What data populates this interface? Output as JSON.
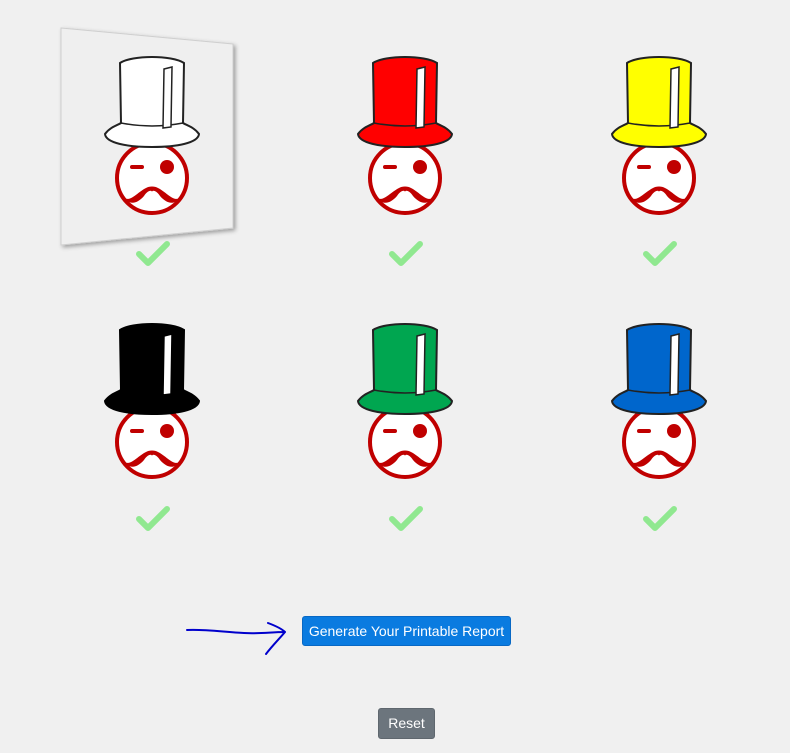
{
  "characters": [
    {
      "hat_color": "#ffffff",
      "selected": true,
      "checked": true
    },
    {
      "hat_color": "#ff0000",
      "selected": false,
      "checked": true
    },
    {
      "hat_color": "#ffff00",
      "selected": false,
      "checked": true
    },
    {
      "hat_color": "#000000",
      "selected": false,
      "checked": true
    },
    {
      "hat_color": "#00a650",
      "selected": false,
      "checked": true
    },
    {
      "hat_color": "#0066cc",
      "selected": false,
      "checked": true
    }
  ],
  "face_color": "#c00000",
  "check_color": "#90e890",
  "actions": {
    "generate_label": "Generate Your Printable Report",
    "reset_label": "Reset"
  },
  "colors": {
    "generate_button": "#0a7be0",
    "reset_button": "#6c757d",
    "annotation_arrow": "#0000cc"
  }
}
